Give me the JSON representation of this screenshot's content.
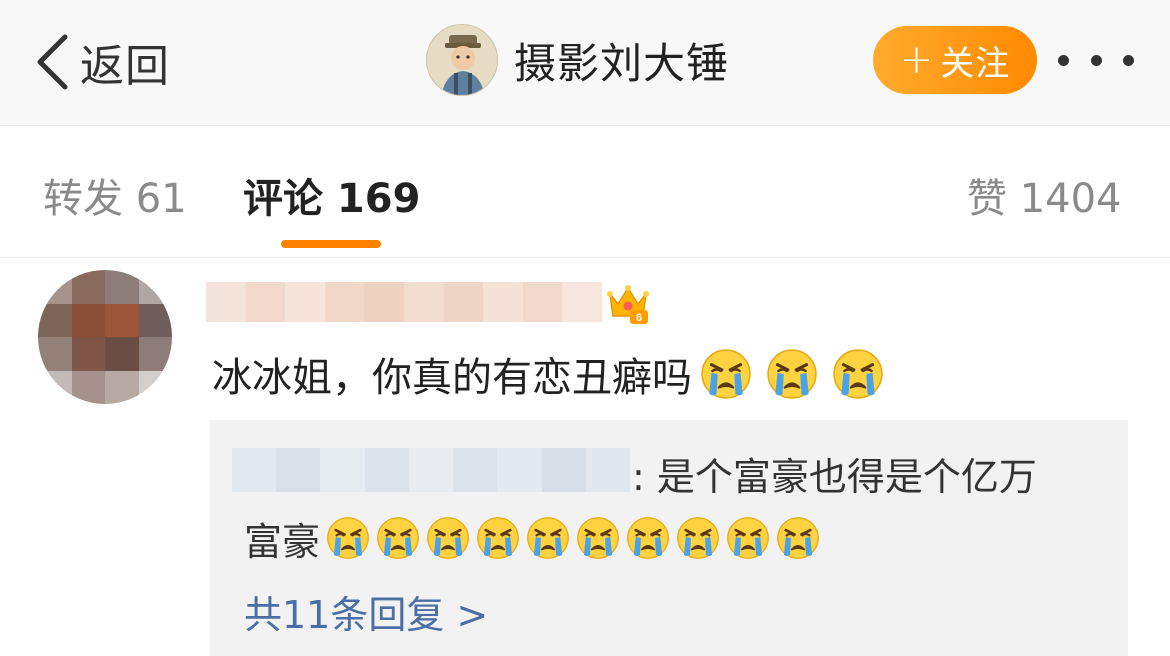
{
  "header": {
    "back_label": "返回",
    "profile_name": "摄影刘大锤",
    "follow_label": "关注",
    "follow_plus": "+",
    "colors": {
      "accent": "#ff8a00",
      "background": "#f8f8f8"
    }
  },
  "tabs": {
    "repost": "转发 61",
    "comments": "评论 169",
    "likes": "赞 1404",
    "active_color": "#ff8200"
  },
  "comment": {
    "badge_icon": "crown-level-icon",
    "badge_level": "6",
    "text": "冰冰姐，你真的有恋丑癖吗",
    "emoji_icon": "crying-face-icon",
    "emoji_count": 3,
    "reply": {
      "line1": ": 是个富豪也得是个亿万",
      "line2": "富豪",
      "emoji_count": 10,
      "more_label": "共11条回复 >",
      "link_color": "#4a6fa5"
    }
  }
}
